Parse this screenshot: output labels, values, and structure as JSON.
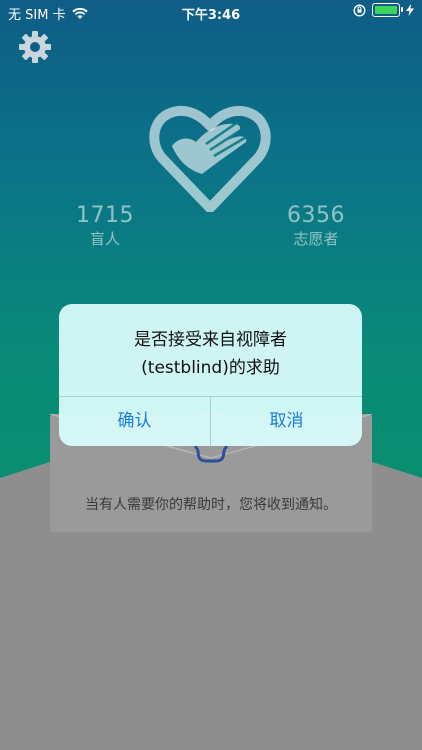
{
  "status_bar": {
    "carrier": "无 SIM 卡",
    "time": "下午3:46",
    "icons": [
      "wifi-icon",
      "orientation-lock-icon",
      "battery-icon",
      "charging-icon"
    ]
  },
  "header": {
    "settings_icon": "gear-icon",
    "logo_icon": "heart-dove-hand-icon"
  },
  "stats": {
    "blind_count": "1715",
    "blind_label": "盲人",
    "volunteer_count": "6356",
    "volunteer_label": "志愿者"
  },
  "card": {
    "icon": "bell-icon",
    "message": "当有人需要你的帮助时，您将收到通知。"
  },
  "dialog": {
    "line1": "是否接受来自视障者",
    "line2": "(testblind)的求助",
    "confirm_label": "确认",
    "cancel_label": "取消"
  },
  "colors": {
    "gradient_top": "#0f5d86",
    "gradient_bottom": "#0a8f6e",
    "dialog_bg": "#d6faf9",
    "button_text": "#1d79d6",
    "overlay_gray": "#8e8e8e"
  }
}
